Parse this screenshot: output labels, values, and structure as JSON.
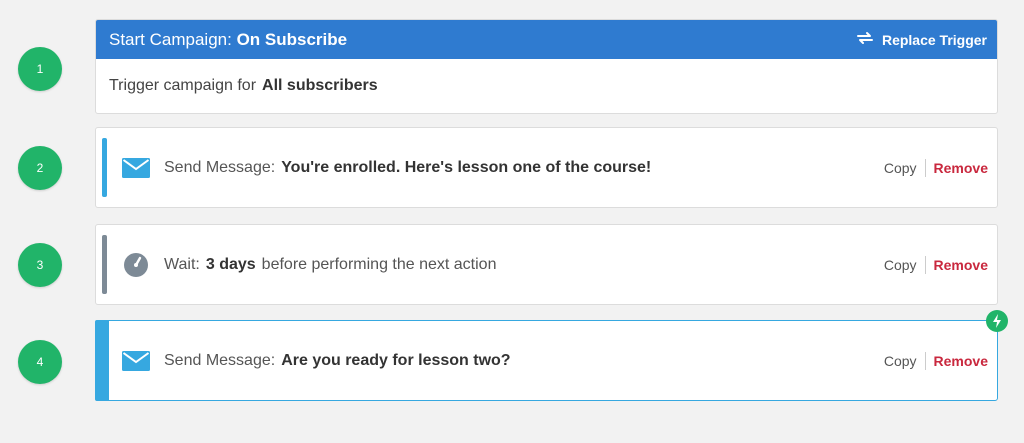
{
  "steps": [
    "1",
    "2",
    "3",
    "4"
  ],
  "trigger": {
    "prefix": "Start Campaign:",
    "name": "On Subscribe",
    "replace_label": "Replace Trigger",
    "body_prefix": "Trigger campaign for",
    "audience": "All subscribers"
  },
  "actions": [
    {
      "prefix": "Send Message:",
      "value": "You're enrolled. Here's lesson one of the course!",
      "icon": "envelope-icon"
    },
    {
      "prefix": "Wait:",
      "value": "3 days",
      "suffix": "before performing the next action",
      "icon": "clock-icon"
    },
    {
      "prefix": "Send Message:",
      "value": "Are you ready for lesson two?",
      "icon": "envelope-icon",
      "active": true
    }
  ],
  "links": {
    "copy": "Copy",
    "remove": "Remove"
  },
  "colors": {
    "header_blue": "#2f7bd0",
    "step_green": "#21b469",
    "accent_blue": "#36a8e0",
    "wait_gray": "#7d8a96",
    "remove_red": "#c9283e"
  }
}
